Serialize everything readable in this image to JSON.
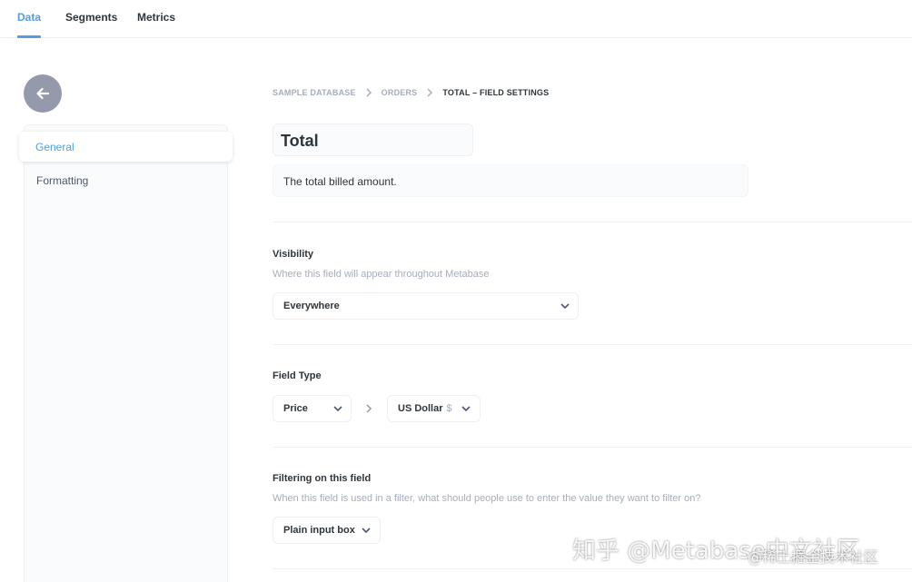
{
  "nav": {
    "tabs": [
      {
        "label": "Data",
        "active": true
      },
      {
        "label": "Segments",
        "active": false
      },
      {
        "label": "Metrics",
        "active": false
      }
    ]
  },
  "sidebar": {
    "items": [
      {
        "label": "General",
        "active": true
      },
      {
        "label": "Formatting",
        "active": false
      }
    ]
  },
  "breadcrumb": [
    "SAMPLE DATABASE",
    "ORDERS",
    "TOTAL – FIELD SETTINGS"
  ],
  "field": {
    "name": "Total",
    "description": "The total billed amount."
  },
  "visibility": {
    "title": "Visibility",
    "description": "Where this field will appear throughout Metabase",
    "value": "Everywhere"
  },
  "field_type": {
    "title": "Field Type",
    "type_value": "Price",
    "currency_value": "US Dollar",
    "currency_symbol": "$"
  },
  "filtering": {
    "title": "Filtering on this field",
    "description": "When this field is used in a filter, what should people use to enter the value they want to filter on?",
    "value": "Plain input box"
  },
  "watermark": {
    "main": "知乎 @Metabase中文社区",
    "sub": "@稀土掘金技术社区"
  },
  "colors": {
    "brand": "#509ee3",
    "text_dark": "#2e353b",
    "text_light": "#a6adbd",
    "border": "#eef0f3"
  }
}
